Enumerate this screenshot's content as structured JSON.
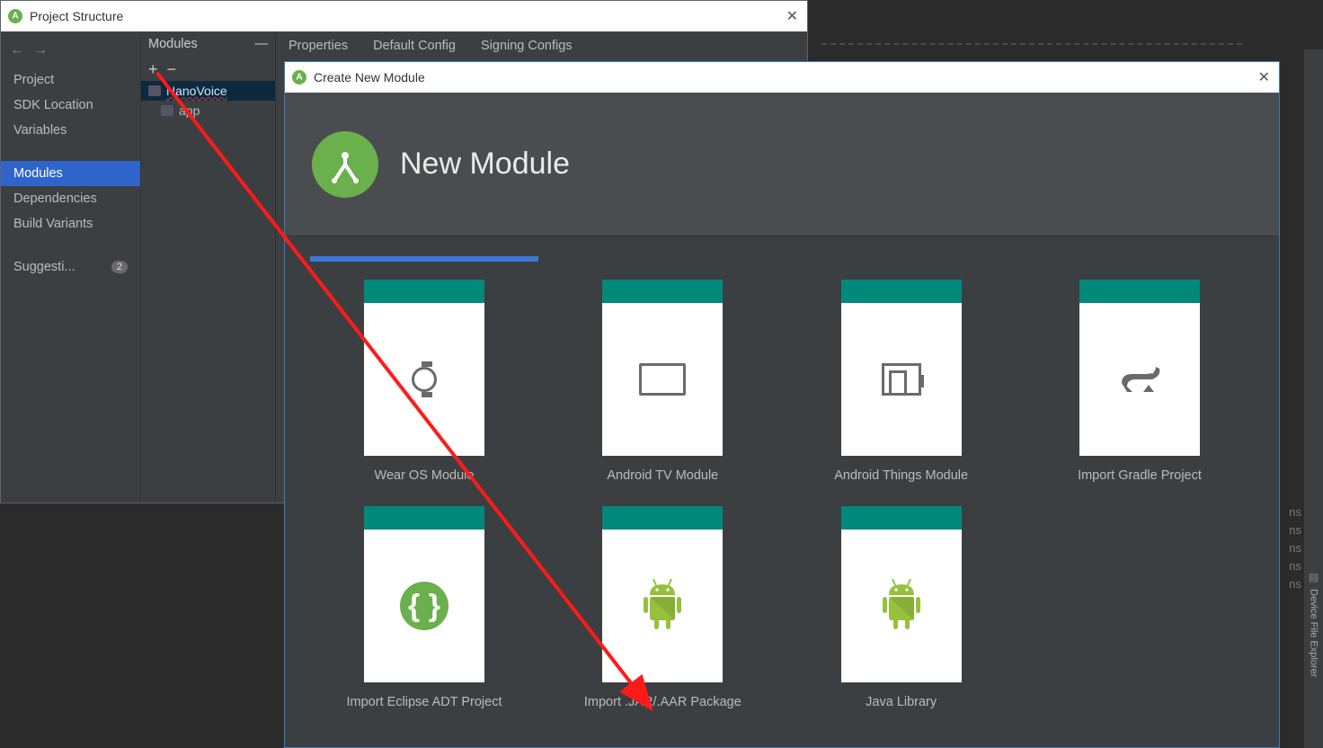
{
  "project_structure": {
    "title": "Project Structure",
    "sidebar": [
      {
        "label": "Project"
      },
      {
        "label": "SDK Location"
      },
      {
        "label": "Variables"
      },
      {
        "label": "Modules",
        "selected": true
      },
      {
        "label": "Dependencies"
      },
      {
        "label": "Build Variants"
      },
      {
        "label": "Suggesti...",
        "badge": "2"
      }
    ],
    "modules_panel": {
      "header": "Modules",
      "tree": [
        {
          "label": "NanoVoice",
          "root": true
        },
        {
          "label": "app"
        }
      ],
      "tools": {
        "add": "+",
        "remove": "−",
        "collapse": "—"
      }
    },
    "tabs": [
      "Properties",
      "Default Config",
      "Signing Configs"
    ]
  },
  "new_module": {
    "title": "Create New Module",
    "hero": "New Module",
    "templates": [
      {
        "name": "Wear OS Module",
        "icon": "watch"
      },
      {
        "name": "Android TV Module",
        "icon": "tv"
      },
      {
        "name": "Android Things Module",
        "icon": "things"
      },
      {
        "name": "Import Gradle Project",
        "icon": "gradle"
      },
      {
        "name": "Import Eclipse ADT Project",
        "icon": "brackets"
      },
      {
        "name": "Import .JAR/.AAR Package",
        "icon": "android"
      },
      {
        "name": "Java Library",
        "icon": "android"
      }
    ]
  },
  "right_gutter": {
    "label": "Device File Explorer"
  },
  "ghost_text": "ns\nns\nns\nns\nns"
}
